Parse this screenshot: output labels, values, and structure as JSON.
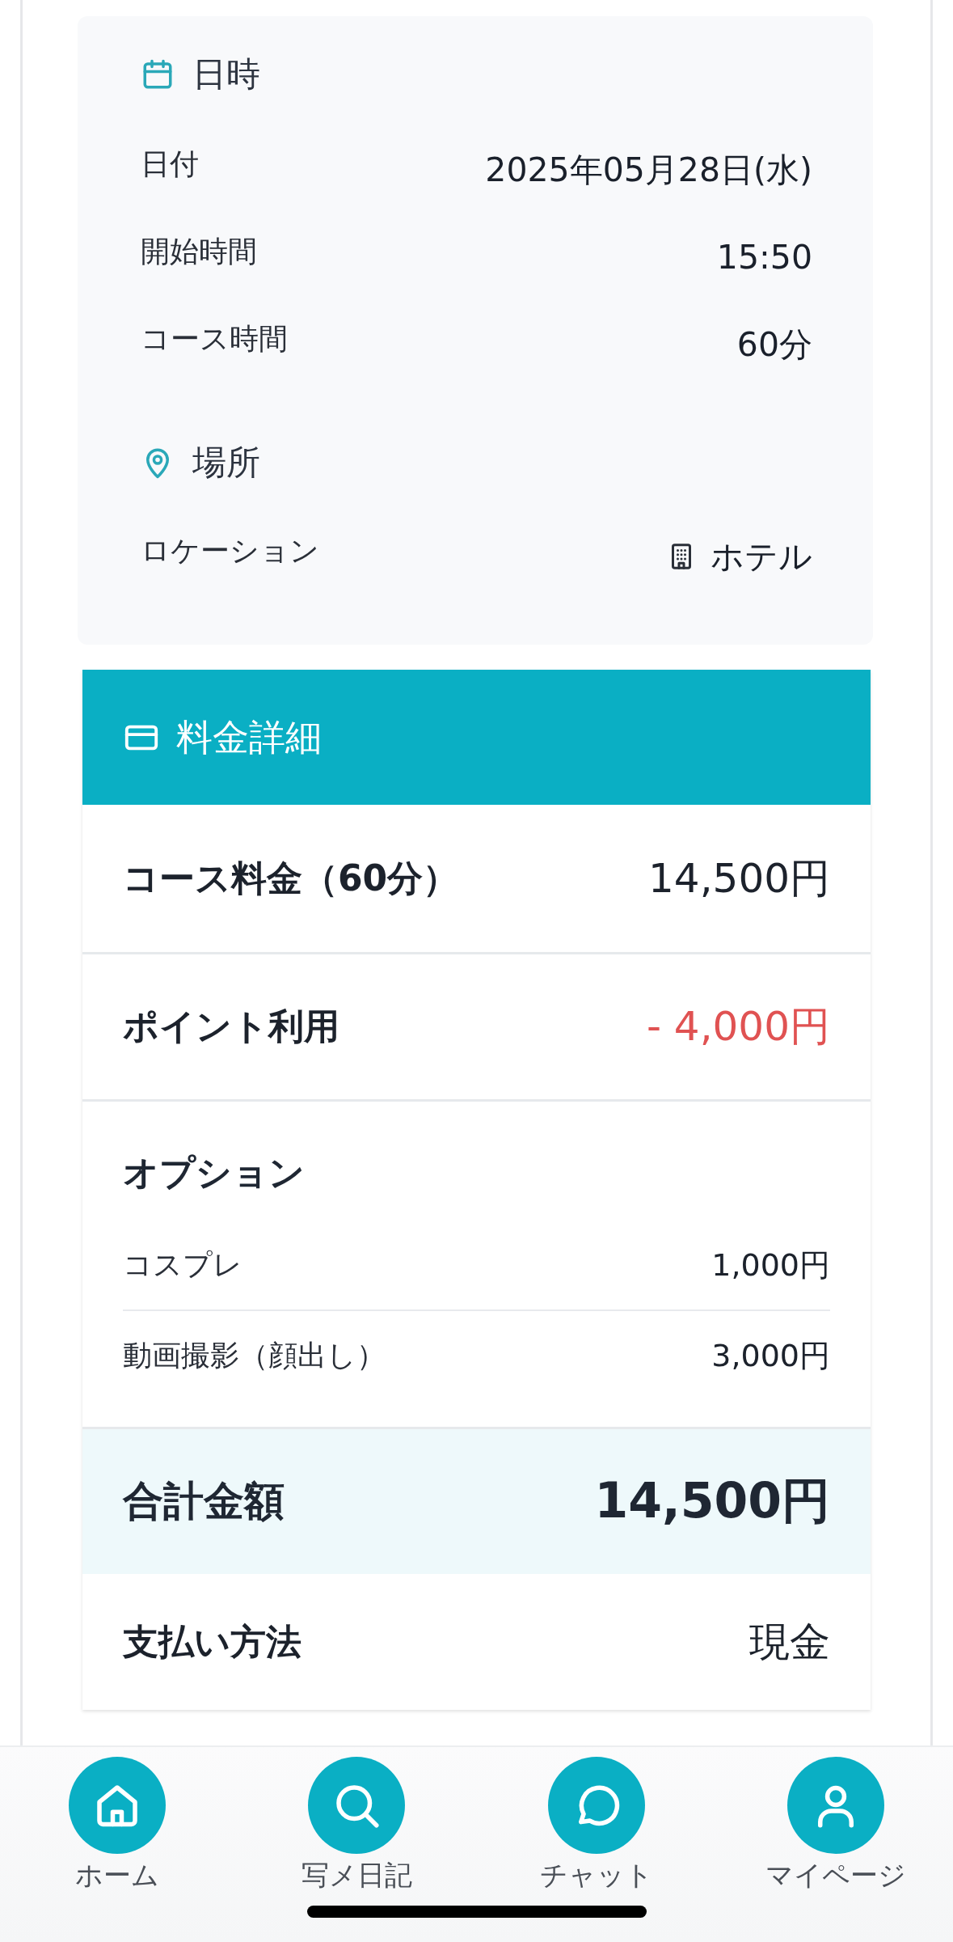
{
  "schedule": {
    "sections": [
      {
        "kind": "datetime",
        "title": "日時",
        "rows": [
          {
            "kind": "plain",
            "label": "日付",
            "value": "2025年05月28日(水)"
          },
          {
            "kind": "plain",
            "label": "開始時間",
            "value": "15:50"
          },
          {
            "kind": "plain",
            "label": "コース時間",
            "value": "60分"
          }
        ]
      },
      {
        "kind": "place",
        "title": "場所",
        "rows": [
          {
            "kind": "building",
            "label": "ロケーション",
            "value": "ホテル"
          }
        ]
      }
    ]
  },
  "fees": {
    "title": "料金詳細",
    "items": [
      {
        "kind": "line",
        "label": "コース料金（60分）",
        "value": "14,500円",
        "negative": false
      },
      {
        "kind": "line",
        "label": "ポイント利用",
        "value": "- 4,000円",
        "negative": true
      },
      {
        "kind": "options",
        "label": "オプション",
        "options": [
          {
            "label": "コスプレ",
            "value": "1,000円"
          },
          {
            "label": "動画撮影（顔出し）",
            "value": "3,000円"
          }
        ]
      },
      {
        "kind": "total",
        "label": "合計金額",
        "value": "14,500円"
      },
      {
        "kind": "line",
        "label": "支払い方法",
        "value": "現金",
        "negative": false
      }
    ]
  },
  "nav": {
    "items": [
      {
        "kind": "home",
        "label": "ホーム"
      },
      {
        "kind": "search",
        "label": "写メ日記"
      },
      {
        "kind": "chat",
        "label": "チャット"
      },
      {
        "kind": "profile",
        "label": "マイページ"
      }
    ]
  }
}
